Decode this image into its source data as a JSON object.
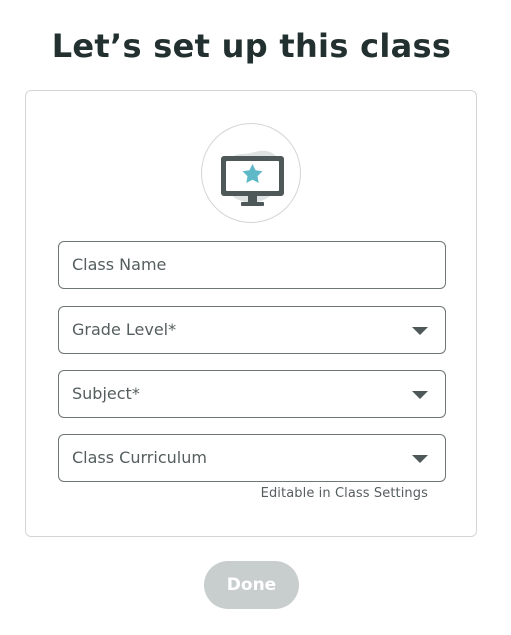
{
  "header": {
    "title": "Let’s set up this class"
  },
  "form": {
    "class_name_placeholder": "Class Name",
    "grade_level_label": "Grade Level*",
    "subject_label": "Subject*",
    "curriculum_label": "Class Curriculum",
    "curriculum_hint": "Editable in Class Settings"
  },
  "actions": {
    "done_label": "Done"
  },
  "icon": {
    "name": "monitor-star-icon",
    "colors": {
      "monitor": "#4f5859",
      "star": "#5fb8c8",
      "blob": "#dfe2e2"
    }
  },
  "colors": {
    "title": "#22302f",
    "button_disabled": "#c8cdcd",
    "border": "#d3d6d6",
    "field_border": "#6e7676"
  }
}
